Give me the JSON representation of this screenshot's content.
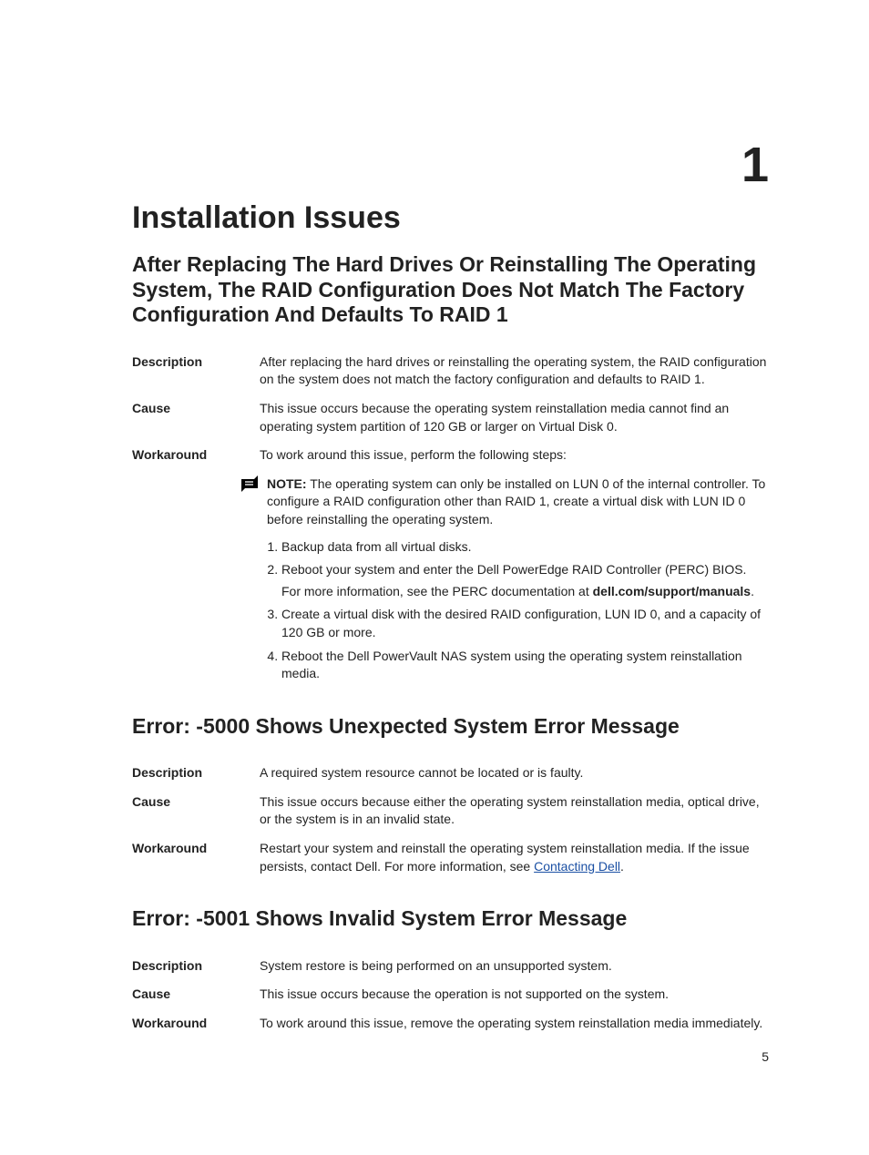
{
  "chapter": {
    "number": "1",
    "title": "Installation Issues"
  },
  "section1": {
    "title": "After Replacing The Hard Drives Or Reinstalling The Operating System, The RAID Configuration Does Not Match The Factory Configuration And Defaults To RAID 1",
    "description_label": "Description",
    "description": "After replacing the hard drives or reinstalling the operating system, the RAID configuration on the system does not match the factory configuration and defaults to RAID 1.",
    "cause_label": "Cause",
    "cause": "This issue occurs because the operating system reinstallation media cannot find an operating system partition of 120 GB or larger on Virtual Disk 0.",
    "workaround_label": "Workaround",
    "workaround_intro": "To work around this issue, perform the following steps:",
    "note_label": "NOTE:",
    "note_text": " The operating system can only be installed on LUN 0 of the internal controller. To configure a RAID configuration other than RAID 1, create a virtual disk with LUN ID 0 before reinstalling the operating system.",
    "steps": {
      "s1": "Backup data from all virtual disks.",
      "s2": "Reboot your system and enter the Dell PowerEdge RAID Controller (PERC) BIOS.",
      "s2b_prefix": "For more information, see the PERC documentation at ",
      "s2b_bold": "dell.com/support/manuals",
      "s2b_suffix": ".",
      "s3": "Create a virtual disk with the desired RAID configuration, LUN ID 0, and a capacity of 120 GB or more.",
      "s4": "Reboot the Dell PowerVault NAS system using the operating system reinstallation media."
    }
  },
  "section2": {
    "title": "Error: -5000 Shows Unexpected System Error Message",
    "description_label": "Description",
    "description": "A required system resource cannot be located or is faulty.",
    "cause_label": "Cause",
    "cause": "This issue occurs because either the operating system reinstallation media, optical drive, or the system is in an invalid state.",
    "workaround_label": "Workaround",
    "workaround_prefix": "Restart your system and reinstall the operating system reinstallation media. If the issue persists, contact Dell. For more information, see ",
    "workaround_link": "Contacting Dell",
    "workaround_suffix": "."
  },
  "section3": {
    "title": "Error: -5001 Shows Invalid System Error Message",
    "description_label": "Description",
    "description": "System restore is being performed on an unsupported system.",
    "cause_label": "Cause",
    "cause": "This issue occurs because the operation is not supported on the system.",
    "workaround_label": "Workaround",
    "workaround": "To work around this issue, remove the operating system reinstallation media immediately."
  },
  "page_number": "5"
}
